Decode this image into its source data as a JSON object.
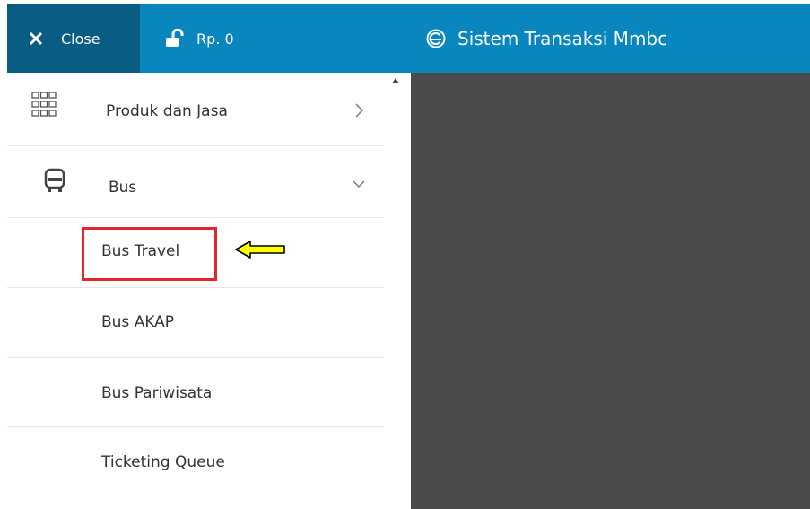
{
  "topbar": {
    "close_label": "Close",
    "balance_label": "Rp. 0",
    "app_title": "Sistem Transaksi Mmbc",
    "colors": {
      "bar": "#0a86be",
      "close_bg": "#0a5d82"
    }
  },
  "sidebar": {
    "items": [
      {
        "label": "Produk dan Jasa",
        "icon": "grid-icon",
        "chevron": "chevron-right"
      },
      {
        "label": "Bus",
        "icon": "bus-icon",
        "chevron": "chevron-down",
        "expanded": true
      },
      {
        "label": "Bus Travel",
        "highlighted": true
      },
      {
        "label": "Bus AKAP"
      },
      {
        "label": "Bus Pariwisata"
      },
      {
        "label": "Ticketing Queue"
      }
    ]
  },
  "annotation": {
    "highlight_color": "#e3242b",
    "arrow_color": "#ffff00"
  },
  "content": {
    "background": "#4a4a4c"
  }
}
